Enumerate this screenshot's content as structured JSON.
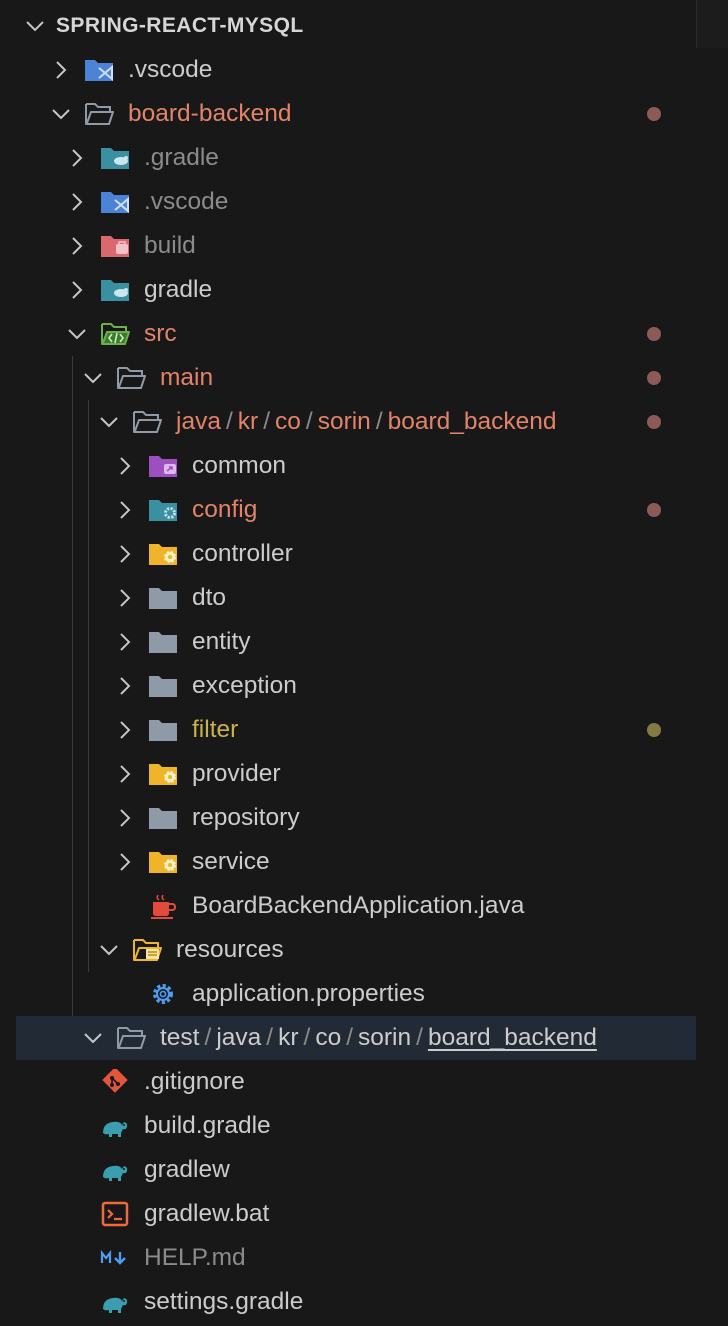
{
  "explorer": {
    "root_title": "SPRING-REACT-MYSQL",
    "colors": {
      "modified": "#e2836a",
      "ignored": "#8b8b8b",
      "warning": "#c9b14c",
      "modified_dot": "#8c5b57",
      "warning_dot": "#827a45",
      "selected_row": "#222a35"
    },
    "items": [
      {
        "label": ".vscode",
        "icon": "vscode-folder-icon",
        "state": "collapsed"
      },
      {
        "label": "board-backend",
        "icon": "folder-open-icon",
        "state": "expanded",
        "status": "modified"
      },
      {
        "label": ".gradle",
        "icon": "gradle-folder-icon",
        "state": "collapsed",
        "status": "ignored"
      },
      {
        "label": ".vscode",
        "icon": "vscode-folder-icon",
        "state": "collapsed",
        "status": "ignored"
      },
      {
        "label": "build",
        "icon": "build-folder-icon",
        "state": "collapsed",
        "status": "ignored"
      },
      {
        "label": "gradle",
        "icon": "gradle-folder-icon",
        "state": "collapsed"
      },
      {
        "label": "src",
        "icon": "src-folder-icon",
        "state": "expanded",
        "status": "modified"
      },
      {
        "label": "main",
        "icon": "folder-open-icon",
        "state": "expanded",
        "status": "modified"
      },
      {
        "path": [
          "java",
          "kr",
          "co",
          "sorin",
          "board_backend"
        ],
        "icon": "folder-open-icon",
        "state": "expanded",
        "status": "modified"
      },
      {
        "label": "common",
        "icon": "common-folder-icon",
        "state": "collapsed"
      },
      {
        "label": "config",
        "icon": "config-folder-icon",
        "state": "collapsed",
        "status": "modified"
      },
      {
        "label": "controller",
        "icon": "controller-folder-icon",
        "state": "collapsed"
      },
      {
        "label": "dto",
        "icon": "folder-icon",
        "state": "collapsed"
      },
      {
        "label": "entity",
        "icon": "folder-icon",
        "state": "collapsed"
      },
      {
        "label": "exception",
        "icon": "folder-icon",
        "state": "collapsed"
      },
      {
        "label": "filter",
        "icon": "folder-icon",
        "state": "collapsed",
        "status": "warning"
      },
      {
        "label": "provider",
        "icon": "controller-folder-icon",
        "state": "collapsed"
      },
      {
        "label": "repository",
        "icon": "folder-icon",
        "state": "collapsed"
      },
      {
        "label": "service",
        "icon": "controller-folder-icon",
        "state": "collapsed"
      },
      {
        "label": "BoardBackendApplication.java",
        "icon": "java-file-icon"
      },
      {
        "label": "resources",
        "icon": "resources-folder-icon",
        "state": "expanded"
      },
      {
        "label": "application.properties",
        "icon": "gear-file-icon"
      },
      {
        "path": [
          "test",
          "java",
          "kr",
          "co",
          "sorin",
          "board_backend"
        ],
        "icon": "folder-open-icon",
        "state": "expanded",
        "selected": true
      },
      {
        "label": ".gitignore",
        "icon": "git-file-icon"
      },
      {
        "label": "build.gradle",
        "icon": "gradle-file-icon"
      },
      {
        "label": "gradlew",
        "icon": "gradle-file-icon"
      },
      {
        "label": "gradlew.bat",
        "icon": "terminal-file-icon"
      },
      {
        "label": "HELP.md",
        "icon": "markdown-file-icon",
        "status": "ignored"
      },
      {
        "label": "settings.gradle",
        "icon": "gradle-file-icon"
      }
    ]
  }
}
